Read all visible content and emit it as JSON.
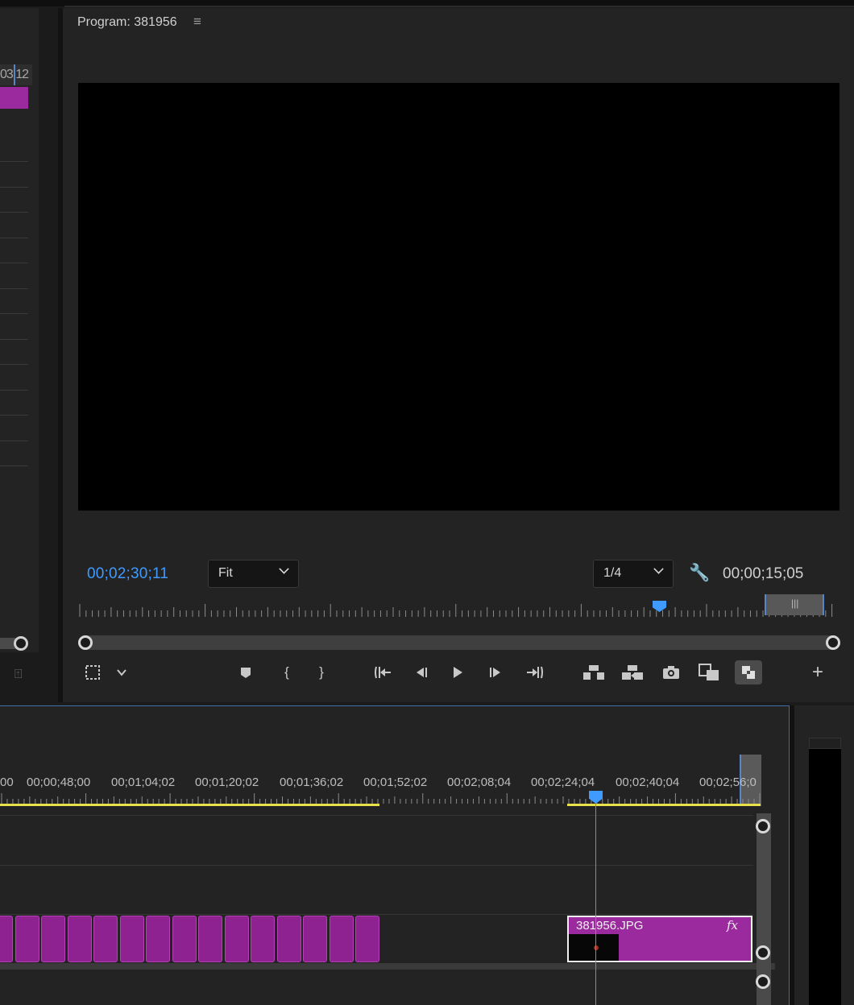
{
  "source_panel": {
    "ruler_label": "03;12"
  },
  "program_monitor": {
    "title": "Program: 381956",
    "menu_icon": "hamburger-menu-icon",
    "current_timecode": "00;02;30;11",
    "fit_select": "Fit",
    "resolution_select": "1/4",
    "duration_timecode": "00;00;15;05",
    "playhead_fraction": 0.765,
    "transport_buttons": [
      {
        "name": "safe-margins",
        "icon": "▢"
      },
      {
        "name": "settings-dropdown",
        "icon": "⌄"
      },
      {
        "name": "add-marker",
        "icon": "⬟"
      },
      {
        "name": "mark-in",
        "icon": "{"
      },
      {
        "name": "mark-out",
        "icon": "}"
      },
      {
        "name": "go-to-in",
        "icon": "{⇤"
      },
      {
        "name": "step-back",
        "icon": "◀|"
      },
      {
        "name": "play",
        "icon": "▶"
      },
      {
        "name": "step-forward",
        "icon": "|▶"
      },
      {
        "name": "go-to-out",
        "icon": "⇥}"
      },
      {
        "name": "lift",
        "icon": "⏏"
      },
      {
        "name": "extract",
        "icon": "⇪"
      },
      {
        "name": "export-frame",
        "icon": "📷"
      },
      {
        "name": "comparison-view",
        "icon": "▤"
      },
      {
        "name": "toggle-proxies",
        "icon": "⇄"
      },
      {
        "name": "button-editor",
        "icon": "+"
      }
    ]
  },
  "timeline": {
    "ruler_labels": [
      "00",
      "00;00;48;00",
      "00;01;04;02",
      "00;01;20;02",
      "00;01;36;02",
      "00;01;52;02",
      "00;02;08;04",
      "00;02;24;04",
      "00;02;40;04",
      "00;02;56;0"
    ],
    "clip": {
      "name": "381956.JPG",
      "fx_badge": "fx"
    },
    "playhead_fraction": 0.75
  },
  "colors": {
    "accent_blue": "#3f9bff",
    "clip_purple": "#9b2a9e",
    "work_area_yellow": "#e8e04a"
  }
}
